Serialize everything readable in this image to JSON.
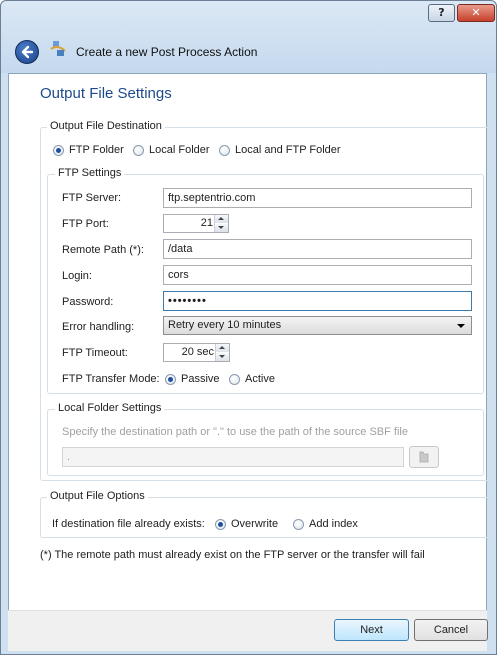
{
  "window": {
    "title": "Create a new Post Process Action",
    "help_label": "?",
    "close_label": "✕"
  },
  "heading": "Output File Settings",
  "destination": {
    "group_label": "Output File Destination",
    "options": [
      "FTP Folder",
      "Local Folder",
      "Local and FTP Folder"
    ],
    "selected": "FTP Folder"
  },
  "ftp": {
    "group_label": "FTP Settings",
    "server_label": "FTP Server:",
    "server_value": "ftp.septentrio.com",
    "port_label": "FTP Port:",
    "port_value": "21",
    "remote_label": "Remote Path (*):",
    "remote_value": "/data",
    "login_label": "Login:",
    "login_value": "cors",
    "password_label": "Password:",
    "password_value": "••••••••",
    "error_label": "Error handling:",
    "error_value": "Retry every 10 minutes",
    "timeout_label": "FTP Timeout:",
    "timeout_value": "20 sec",
    "mode_label": "FTP Transfer Mode:",
    "mode_options": [
      "Passive",
      "Active"
    ],
    "mode_selected": "Passive"
  },
  "local": {
    "group_label": "Local Folder Settings",
    "hint": "Specify the destination path or \".\" to use the path of the source SBF file",
    "path_value": "."
  },
  "options": {
    "group_label": "Output File Options",
    "exists_label": "If destination file already exists:",
    "choices": [
      "Overwrite",
      "Add index"
    ],
    "selected": "Overwrite"
  },
  "note": "(*) The remote path must already exist on the FTP server or the transfer will fail",
  "buttons": {
    "next": "Next",
    "cancel": "Cancel"
  }
}
